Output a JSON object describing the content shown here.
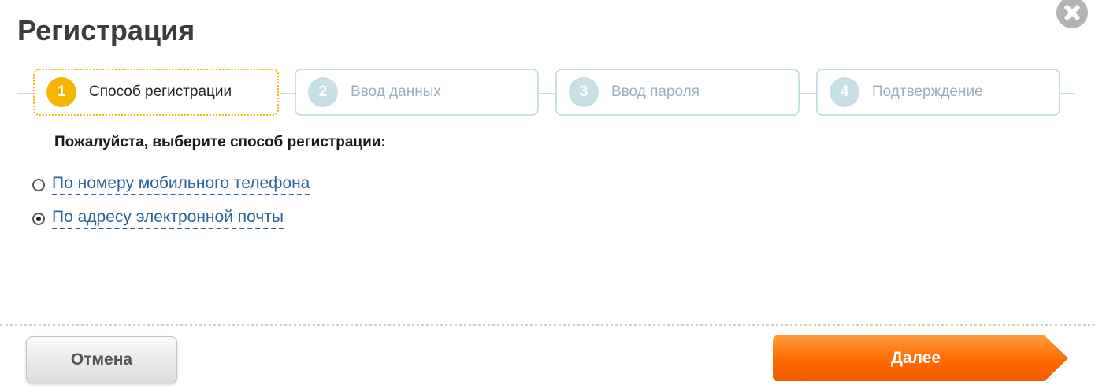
{
  "dialog": {
    "title": "Регистрация"
  },
  "steps": [
    {
      "number": "1",
      "label": "Способ регистрации",
      "active": true
    },
    {
      "number": "2",
      "label": "Ввод данных",
      "active": false
    },
    {
      "number": "3",
      "label": "Ввод пароля",
      "active": false
    },
    {
      "number": "4",
      "label": "Подтверждение",
      "active": false
    }
  ],
  "form": {
    "prompt": "Пожалуйста, выберите способ регистрации:",
    "options": [
      {
        "label": "По номеру мобильного телефона",
        "selected": false
      },
      {
        "label": "По адресу электронной почты",
        "selected": true
      }
    ]
  },
  "footer": {
    "cancel_label": "Отмена",
    "next_label": "Далее"
  },
  "colors": {
    "accent_orange": "#ff6a00",
    "active_step": "#f5b400",
    "inactive_step": "#c9dfe6",
    "link": "#2a6496"
  },
  "icons": {
    "close": "close-icon"
  }
}
